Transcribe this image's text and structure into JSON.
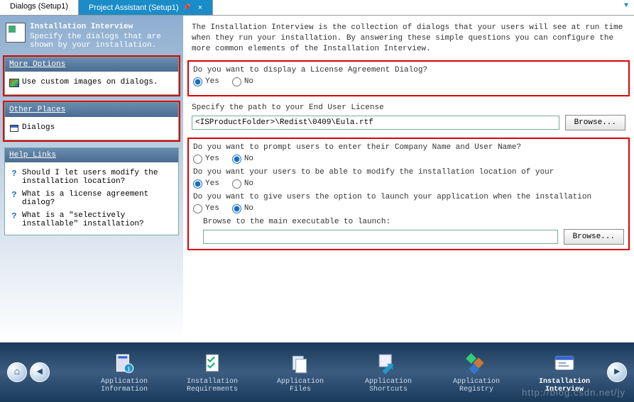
{
  "tabs": {
    "inactive": "Dialogs (Setup1)",
    "active": "Project Assistant (Setup1)"
  },
  "title": {
    "heading": "Installation Interview",
    "sub": "Specify the dialogs that are shown by your installation."
  },
  "panels": {
    "more_options": {
      "title": "More Options",
      "items": [
        "Use custom images on dialogs."
      ]
    },
    "other_places": {
      "title": "Other Places",
      "items": [
        "Dialogs"
      ]
    },
    "help_links": {
      "title": "Help Links",
      "items": [
        "Should I let users modify the installation location?",
        "What is a license agreement dialog?",
        "What is a \"selectively installable\" installation?"
      ]
    }
  },
  "content": {
    "intro": "The Installation Interview is the collection of dialogs that your users will see at run time when they run your installation. By answering these simple questions you can configure the more common elements of the Installation Interview.",
    "q1": "Do you want to display a License Agreement Dialog?",
    "yes": "Yes",
    "no": "No",
    "path_label": "Specify the path to your End User License",
    "path_value": "<ISProductFolder>\\Redist\\0409\\Eula.rtf",
    "browse": "Browse...",
    "q2": "Do you want to prompt users to enter their Company Name and User Name?",
    "q3": "Do you want your users to be able to modify the installation location of your",
    "q4": "Do you want to give users the option to launch your application when the installation",
    "exe_label": "Browse to the main executable to launch:",
    "exe_value": ""
  },
  "bottom": {
    "items": [
      "Application\nInformation",
      "Installation\nRequirements",
      "Application\nFiles",
      "Application\nShortcuts",
      "Application\nRegistry",
      "Installation\nInterview"
    ]
  },
  "watermark": "http://blog.csdn.net/jy"
}
